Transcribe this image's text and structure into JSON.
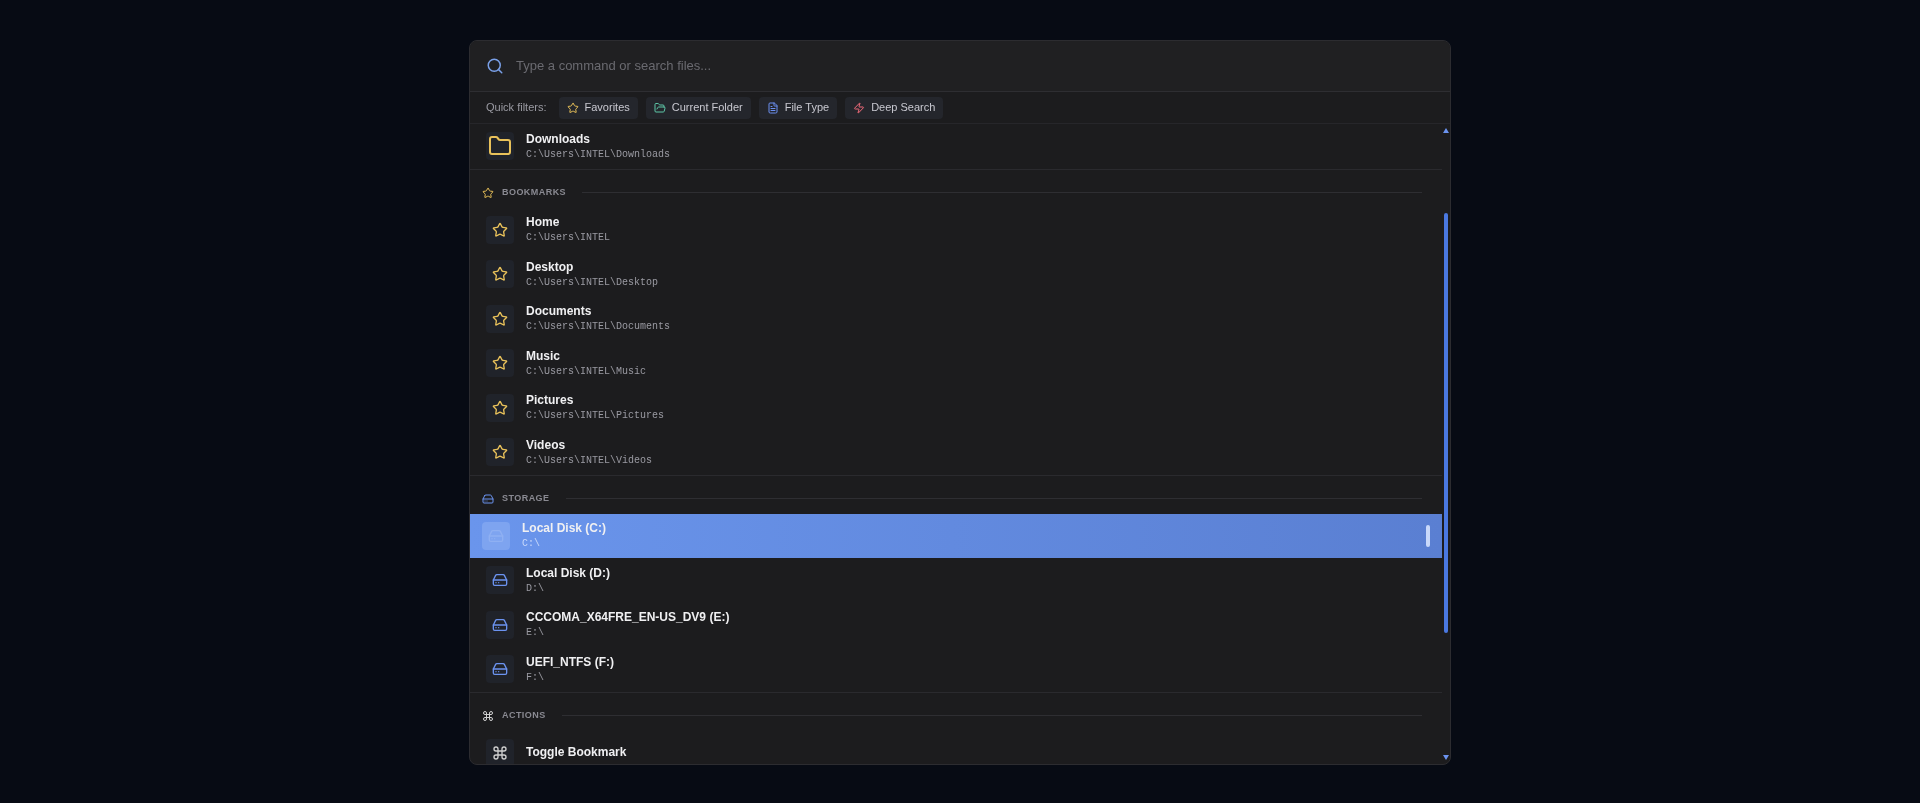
{
  "search": {
    "placeholder": "Type a command or search files..."
  },
  "quick_filters": {
    "label": "Quick filters:",
    "filters": [
      {
        "label": "Favorites",
        "kind": "star"
      },
      {
        "label": "Current Folder",
        "kind": "folder"
      },
      {
        "label": "File Type",
        "kind": "file"
      },
      {
        "label": "Deep Search",
        "kind": "bolt"
      }
    ]
  },
  "sections": [
    {
      "kind": "folder",
      "items": [
        {
          "name": "Downloads",
          "path": "C:\\Users\\INTEL\\Downloads",
          "selected": false
        }
      ]
    },
    {
      "title": "BOOKMARKS",
      "kind": "star",
      "items": [
        {
          "name": "Home",
          "path": "C:\\Users\\INTEL",
          "selected": false
        },
        {
          "name": "Desktop",
          "path": "C:\\Users\\INTEL\\Desktop",
          "selected": false
        },
        {
          "name": "Documents",
          "path": "C:\\Users\\INTEL\\Documents",
          "selected": false
        },
        {
          "name": "Music",
          "path": "C:\\Users\\INTEL\\Music",
          "selected": false
        },
        {
          "name": "Pictures",
          "path": "C:\\Users\\INTEL\\Pictures",
          "selected": false
        },
        {
          "name": "Videos",
          "path": "C:\\Users\\INTEL\\Videos",
          "selected": false
        }
      ]
    },
    {
      "title": "STORAGE",
      "kind": "drive",
      "items": [
        {
          "name": "Local Disk (C:)",
          "path": "C:\\",
          "selected": true
        },
        {
          "name": "Local Disk (D:)",
          "path": "D:\\",
          "selected": false
        },
        {
          "name": "CCCOMA_X64FRE_EN-US_DV9 (E:)",
          "path": "E:\\",
          "selected": false
        },
        {
          "name": "UEFI_NTFS (F:)",
          "path": "F:\\",
          "selected": false
        }
      ]
    },
    {
      "title": "ACTIONS",
      "kind": "command",
      "items": [
        {
          "name": "Toggle Bookmark",
          "selected": false
        }
      ]
    }
  ]
}
